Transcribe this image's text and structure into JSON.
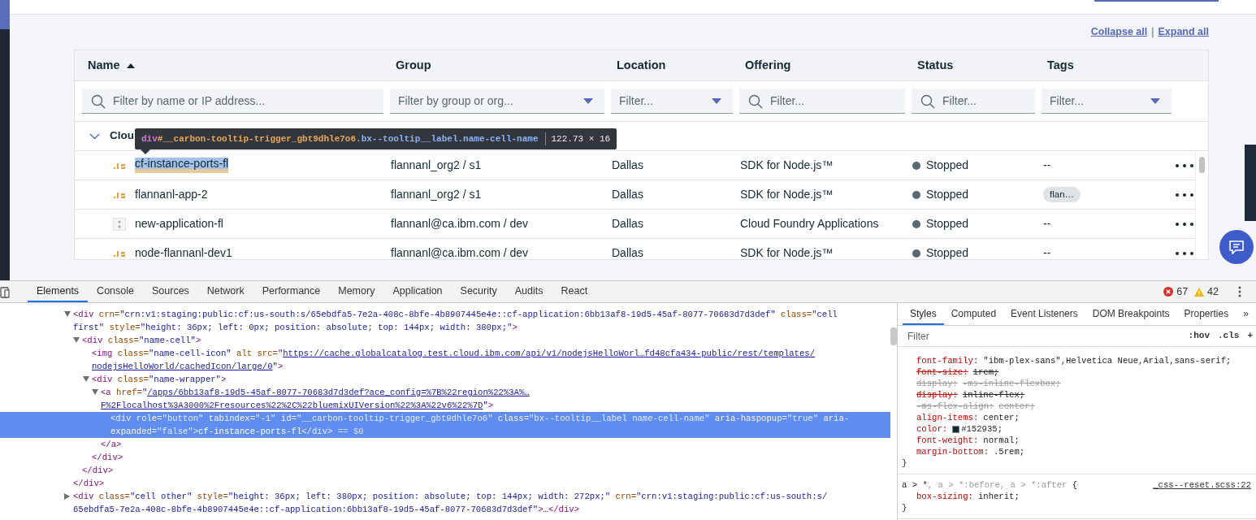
{
  "links": {
    "items": [
      {
        "label": "Collapse all"
      },
      {
        "label": "Expand all"
      }
    ],
    "separator": "|"
  },
  "table": {
    "columns": [
      {
        "label": "Name",
        "sorted": true
      },
      {
        "label": "Group",
        "sorted": false
      },
      {
        "label": "Location",
        "sorted": false
      },
      {
        "label": "Offering",
        "sorted": false
      },
      {
        "label": "Status",
        "sorted": false
      },
      {
        "label": "Tags",
        "sorted": false
      }
    ],
    "filters": [
      {
        "kind": "search",
        "placeholder": "Filter by name or IP address..."
      },
      {
        "kind": "dropdown",
        "placeholder": "Filter by group or org..."
      },
      {
        "kind": "dropdown",
        "placeholder": "Filter..."
      },
      {
        "kind": "search",
        "placeholder": "Filter..."
      },
      {
        "kind": "search",
        "placeholder": "Filter..."
      },
      {
        "kind": "dropdown",
        "placeholder": "Filter..."
      }
    ],
    "group": {
      "label": "Clou",
      "expanded": true
    },
    "rows": [
      {
        "kind": "nodejs",
        "name": "cf-instance-ports-fl",
        "selected": true,
        "group": "flannanl_org2 / s1",
        "location": "Dallas",
        "offering": "SDK for Node.js™",
        "status": "Stopped",
        "tags": {
          "kind": "text",
          "text": "--"
        }
      },
      {
        "kind": "nodejs",
        "name": "flannanl-app-2",
        "selected": false,
        "group": "flannanl_org2 / s1",
        "location": "Dallas",
        "offering": "SDK for Node.js™",
        "status": "Stopped",
        "tags": {
          "kind": "chip",
          "text": "flan…"
        }
      },
      {
        "kind": "generic",
        "name": "new-application-fl",
        "selected": false,
        "group": "flannanl@ca.ibm.com / dev",
        "location": "Dallas",
        "offering": "Cloud Foundry Applications",
        "status": "Stopped",
        "tags": {
          "kind": "text",
          "text": "--"
        }
      },
      {
        "kind": "nodejs",
        "name": "node-flannanl-dev1",
        "selected": false,
        "group": "flannanl@ca.ibm.com / dev",
        "location": "Dallas",
        "offering": "SDK for Node.js™",
        "status": "Stopped",
        "tags": {
          "kind": "text",
          "text": "--"
        }
      }
    ]
  },
  "tooltip": {
    "parts": [
      {
        "kind": "tag",
        "text": "div"
      },
      {
        "kind": "id",
        "text": "#__carbon-tooltip-trigger_gbt9dhle7o6"
      },
      {
        "kind": "class",
        "text": ".bx--tooltip__label.name-cell-name"
      }
    ],
    "size": "122.73 × 16"
  },
  "devtools": {
    "tabs": [
      {
        "label": "Elements",
        "selected": true
      },
      {
        "label": "Console",
        "selected": false
      },
      {
        "label": "Sources",
        "selected": false
      },
      {
        "label": "Network",
        "selected": false
      },
      {
        "label": "Performance",
        "selected": false
      },
      {
        "label": "Memory",
        "selected": false
      },
      {
        "label": "Application",
        "selected": false
      },
      {
        "label": "Security",
        "selected": false
      },
      {
        "label": "Audits",
        "selected": false
      },
      {
        "label": "React",
        "selected": false
      }
    ],
    "errors": "67",
    "warnings": "42",
    "dom": [
      {
        "selected": false,
        "expanded": true,
        "lines": [
          [
            {
              "kind": "tag",
              "text": "<div"
            },
            {
              "kind": "attr",
              "text": " crn="
            },
            {
              "kind": "value",
              "text": "\"crn:v1:staging:public:cf:us-south:s/65ebdfa5-7e2a-408c-8bfe-4b8907445e4e::cf-application:6bb13af8-19d5-45af-8077-70683d7d3def\""
            },
            {
              "kind": "attr",
              "text": " class="
            },
            {
              "kind": "value",
              "text": "\"cell"
            }
          ],
          [
            {
              "kind": "value",
              "text": "first\""
            },
            {
              "kind": "attr",
              "text": " style="
            },
            {
              "kind": "value",
              "text": "\"height: 36px; left: 0px; position: absolute; top: 144px; width: 380px;\""
            },
            {
              "kind": "tag",
              "text": ">"
            }
          ]
        ],
        "close": [
          {
            "kind": "tag",
            "text": "</div>"
          }
        ],
        "children": [
          {
            "selected": false,
            "expanded": true,
            "lines": [
              [
                {
                  "kind": "tag",
                  "text": "<div"
                },
                {
                  "kind": "attr",
                  "text": " class="
                },
                {
                  "kind": "value",
                  "text": "\"name-cell\""
                },
                {
                  "kind": "tag",
                  "text": ">"
                }
              ]
            ],
            "close": [
              {
                "kind": "tag",
                "text": "</div>"
              }
            ],
            "children": [
              {
                "selected": false,
                "lines": [
                  [
                    {
                      "kind": "tag",
                      "text": "<img"
                    },
                    {
                      "kind": "attr",
                      "text": " class="
                    },
                    {
                      "kind": "value",
                      "text": "\"name-cell-icon\""
                    },
                    {
                      "kind": "attr",
                      "text": " alt src="
                    },
                    {
                      "kind": "value",
                      "text": "\""
                    },
                    {
                      "kind": "link",
                      "text": "https://cache.globalcatalog.test.cloud.ibm.com/api/v1/nodejsHelloWorl…fd48cfa434-public/rest/templates/"
                    }
                  ],
                  [
                    {
                      "kind": "link",
                      "text": "nodejsHelloWorld/cachedIcon/large/0"
                    },
                    {
                      "kind": "value",
                      "text": "\""
                    },
                    {
                      "kind": "tag",
                      "text": ">"
                    }
                  ]
                ]
              },
              {
                "selected": false,
                "expanded": true,
                "lines": [
                  [
                    {
                      "kind": "tag",
                      "text": "<div"
                    },
                    {
                      "kind": "attr",
                      "text": " class="
                    },
                    {
                      "kind": "value",
                      "text": "\"name-wrapper\""
                    },
                    {
                      "kind": "tag",
                      "text": ">"
                    }
                  ]
                ],
                "close": [
                  {
                    "kind": "tag",
                    "text": "</div>"
                  }
                ],
                "children": [
                  {
                    "selected": false,
                    "expanded": true,
                    "lines": [
                      [
                        {
                          "kind": "tag",
                          "text": "<a"
                        },
                        {
                          "kind": "attr",
                          "text": " href="
                        },
                        {
                          "kind": "value",
                          "text": "\""
                        },
                        {
                          "kind": "link",
                          "text": "/apps/6bb13af8-19d5-45af-8077-70683d7d3def?ace_config=%7B%22region%22%3A%…"
                        }
                      ],
                      [
                        {
                          "kind": "link",
                          "text": "F%2Flocalhost%3A3000%2Fresources%22%2C%22bluemixUIVersion%22%3A%22v6%22%7D"
                        },
                        {
                          "kind": "value",
                          "text": "\""
                        },
                        {
                          "kind": "tag",
                          "text": ">"
                        }
                      ]
                    ],
                    "close": [
                      {
                        "kind": "tag",
                        "text": "</a>"
                      }
                    ],
                    "children": [
                      {
                        "selected": true,
                        "lines": [
                          [
                            {
                              "kind": "tag",
                              "text": "<div"
                            },
                            {
                              "kind": "attr",
                              "text": " role="
                            },
                            {
                              "kind": "value",
                              "text": "\"button\""
                            },
                            {
                              "kind": "attr",
                              "text": " tabindex="
                            },
                            {
                              "kind": "value",
                              "text": "\"-1\""
                            },
                            {
                              "kind": "attr",
                              "text": " id="
                            },
                            {
                              "kind": "value",
                              "text": "\"__carbon-tooltip-trigger_gbt9dhle7o6\""
                            },
                            {
                              "kind": "attr",
                              "text": " class="
                            },
                            {
                              "kind": "value",
                              "text": "\"bx--tooltip__label name-cell-name\""
                            },
                            {
                              "kind": "attr",
                              "text": " aria-haspopup="
                            },
                            {
                              "kind": "value",
                              "text": "\"true\""
                            },
                            {
                              "kind": "attr",
                              "text": " aria-"
                            }
                          ],
                          [
                            {
                              "kind": "attr",
                              "text": "expanded="
                            },
                            {
                              "kind": "value",
                              "text": "\"false\""
                            },
                            {
                              "kind": "tag",
                              "text": ">"
                            },
                            {
                              "kind": "text",
                              "text": "cf-instance-ports-fl"
                            },
                            {
                              "kind": "tag",
                              "text": "</div>"
                            },
                            {
                              "kind": "ref",
                              "text": " == $0"
                            }
                          ]
                        ]
                      }
                    ]
                  }
                ]
              }
            ]
          }
        ]
      },
      {
        "selected": false,
        "expanded": false,
        "lines": [
          [
            {
              "kind": "tag",
              "text": "<div"
            },
            {
              "kind": "attr",
              "text": " class="
            },
            {
              "kind": "value",
              "text": "\"cell other\""
            },
            {
              "kind": "attr",
              "text": " style="
            },
            {
              "kind": "value",
              "text": "\"height: 36px; left: 380px; position: absolute; top: 144px; width: 272px;\""
            },
            {
              "kind": "attr",
              "text": " crn="
            },
            {
              "kind": "value",
              "text": "\"crn:v1:staging:public:cf:us-south:s/"
            }
          ],
          [
            {
              "kind": "value",
              "text": "65ebdfa5-7e2a-408c-8bfe-4b8907445e4e::cf-application:6bb13af8-19d5-45af-8077-70683d7d3def\""
            },
            {
              "kind": "tag",
              "text": ">"
            },
            {
              "kind": "text",
              "text": "…"
            },
            {
              "kind": "tag",
              "text": "</div>"
            }
          ]
        ]
      }
    ],
    "styles": {
      "tabs": [
        {
          "label": "Styles",
          "selected": true
        },
        {
          "label": "Computed",
          "selected": false
        },
        {
          "label": "Event Listeners",
          "selected": false
        },
        {
          "label": "DOM Breakpoints",
          "selected": false
        },
        {
          "label": "Properties",
          "selected": false
        },
        {
          "label": "»",
          "selected": false
        }
      ],
      "filter_placeholder": "Filter",
      "buttons": [
        ":hov",
        ".cls",
        "+"
      ],
      "rules": [
        {
          "declarations": [
            {
              "prop": "font-family:",
              "value": "\"ibm-plex-sans\",Helvetica Neue,Arial,sans-serif;",
              "overridden": false,
              "inactive": false
            },
            {
              "prop": "font-size:",
              "value": "1rem;",
              "overridden": true,
              "inactive": false
            },
            {
              "prop": "display:",
              "value": "-ms-inline-flexbox;",
              "overridden": true,
              "inactive": true
            },
            {
              "prop": "display:",
              "value": "inline-flex;",
              "overridden": true,
              "inactive": false
            },
            {
              "prop": "-ms-flex-align:",
              "value": "center;",
              "overridden": true,
              "inactive": true
            },
            {
              "prop": "align-items:",
              "value": "center;",
              "overridden": false,
              "inactive": false
            },
            {
              "prop": "color:",
              "color": "#152935",
              "value": "#152935;",
              "overridden": false,
              "inactive": false
            },
            {
              "prop": "font-weight:",
              "value": "normal;",
              "overridden": false,
              "inactive": false
            },
            {
              "prop": "margin-bottom:",
              "value": ".5rem;",
              "overridden": false,
              "inactive": false
            }
          ],
          "close": "}"
        },
        {
          "selector": [
            {
              "text": "a > *",
              "matched": true
            },
            {
              "text": ", a > *:before, a > *:after",
              "matched": false
            },
            {
              "text": " {",
              "matched": true
            }
          ],
          "source": "_css--reset.scss:22",
          "declarations": [
            {
              "prop": "box-sizing:",
              "value": "inherit;",
              "overridden": false,
              "inactive": false
            }
          ],
          "close": "}"
        }
      ]
    }
  }
}
